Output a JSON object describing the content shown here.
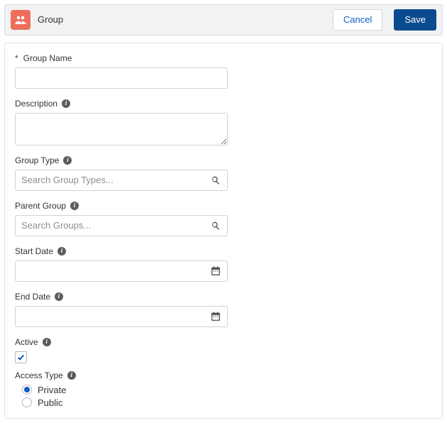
{
  "header": {
    "title": "Group",
    "cancel_label": "Cancel",
    "save_label": "Save",
    "icon": "group-icon"
  },
  "form": {
    "group_name": {
      "label": "Group Name",
      "required": true,
      "value": ""
    },
    "description": {
      "label": "Description",
      "value": "",
      "has_info": true
    },
    "group_type": {
      "label": "Group Type",
      "placeholder": "Search Group Types...",
      "value": "",
      "has_info": true
    },
    "parent_group": {
      "label": "Parent Group",
      "placeholder": "Search Groups...",
      "value": "",
      "has_info": true
    },
    "start_date": {
      "label": "Start Date",
      "value": "",
      "has_info": true
    },
    "end_date": {
      "label": "End Date",
      "value": "",
      "has_info": true
    },
    "active": {
      "label": "Active",
      "checked": true,
      "has_info": true
    },
    "access_type": {
      "label": "Access Type",
      "has_info": true,
      "options": [
        "Private",
        "Public"
      ],
      "selected": "Private"
    }
  }
}
